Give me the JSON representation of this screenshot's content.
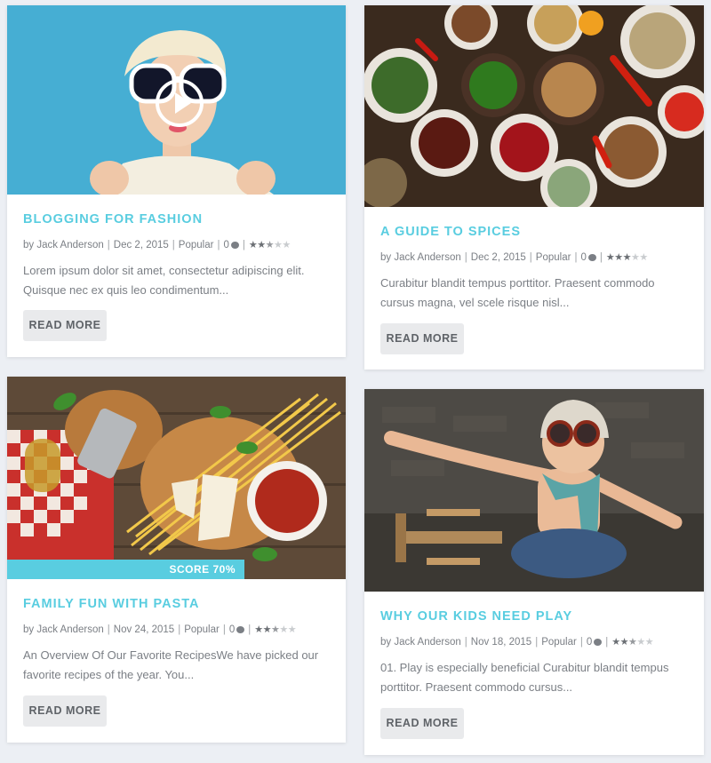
{
  "colors": {
    "accent": "#59cde0",
    "page_bg": "#eceff4",
    "button_bg": "#e9eaec"
  },
  "posts": [
    {
      "title": "BLOGGING FOR FASHION",
      "author": "by Jack Anderson",
      "date": "Dec 2, 2015",
      "category": "Popular",
      "comments": "0",
      "rating": 2.5,
      "excerpt_line1": "Lorem ipsum dolor sit amet, consectetur adipiscing elit.",
      "excerpt_line2": "Quisque nec ex quis leo condimentum...",
      "button": "READ MORE",
      "has_video": true
    },
    {
      "title": "A GUIDE TO SPICES",
      "author": "by Jack Anderson",
      "date": "Dec 2, 2015",
      "category": "Popular",
      "comments": "0",
      "rating": 3,
      "excerpt_line1": "Curabitur blandit tempus porttitor. Praesent commodo",
      "excerpt_line2": "cursus magna, vel scele risque nisl...",
      "button": "READ MORE"
    },
    {
      "title": "FAMILY FUN WITH PASTA",
      "author": "by Jack Anderson",
      "date": "Nov 24, 2015",
      "category": "Popular",
      "comments": "0",
      "rating": 2.5,
      "excerpt_line1": "An Overview Of Our Favorite RecipesWe have picked our",
      "excerpt_line2": "favorite recipes of the year. You...",
      "button": "READ MORE",
      "score": "SCORE 70%"
    },
    {
      "title": "WHY OUR KIDS NEED PLAY",
      "author": "by Jack Anderson",
      "date": "Nov 18, 2015",
      "category": "Popular",
      "comments": "0",
      "rating": 2.5,
      "excerpt_line1": "01. Play is especially beneficial Curabitur blandit tempus",
      "excerpt_line2": "porttitor. Praesent commodo cursus...",
      "button": "READ MORE"
    }
  ]
}
